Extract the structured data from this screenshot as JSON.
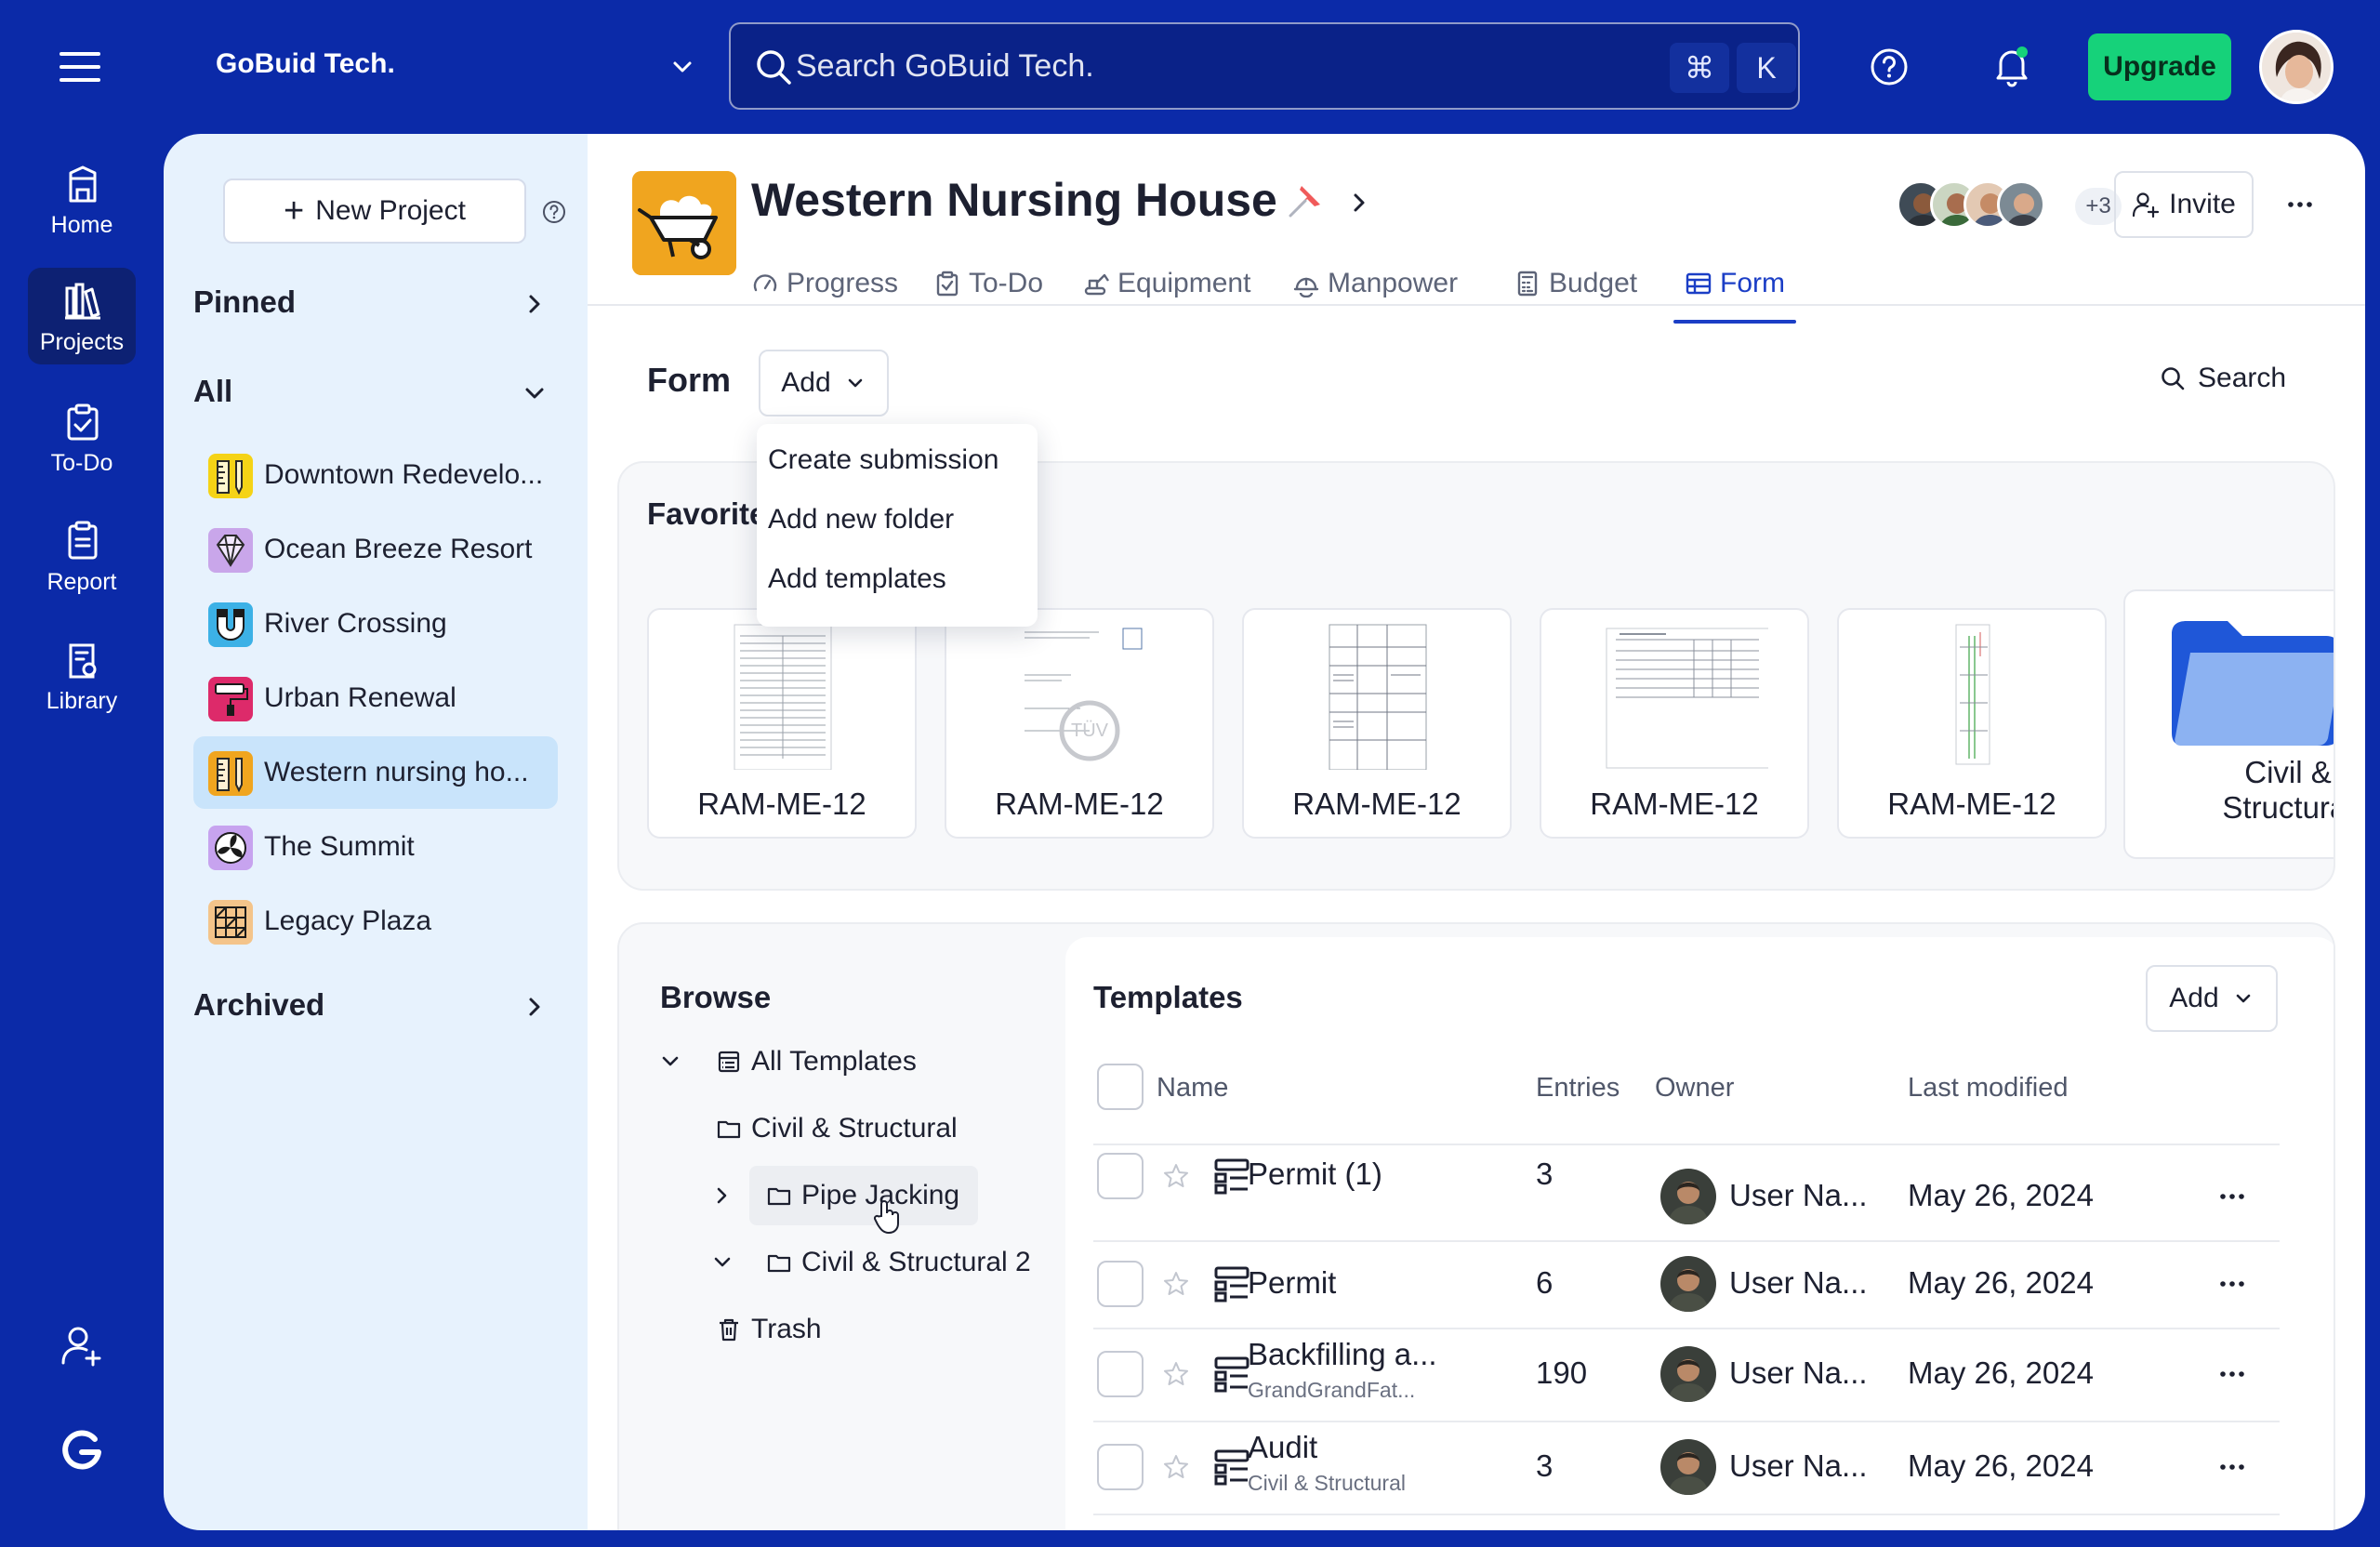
{
  "topbar": {
    "org_name": "GoBuid Tech.",
    "search_placeholder": "Search GoBuid Tech.",
    "shortcut_keys": [
      "⌘",
      "K"
    ],
    "upgrade_label": "Upgrade"
  },
  "nav": {
    "items": [
      {
        "label": "Home",
        "icon": "home-icon"
      },
      {
        "label": "Projects",
        "icon": "projects-icon",
        "active": true
      },
      {
        "label": "To-Do",
        "icon": "todo-icon"
      },
      {
        "label": "Report",
        "icon": "report-icon"
      },
      {
        "label": "Library",
        "icon": "library-icon"
      }
    ]
  },
  "sidebar": {
    "new_project_label": "New Project",
    "pinned_label": "Pinned",
    "all_label": "All",
    "archived_label": "Archived",
    "projects": [
      {
        "name": "Downtown Redevelo...",
        "color": "#f5d316"
      },
      {
        "name": "Ocean Breeze Resort",
        "color": "#b38ad8"
      },
      {
        "name": "River Crossing",
        "color": "#3cb1e6"
      },
      {
        "name": "Urban Renewal",
        "color": "#dd2a6a"
      },
      {
        "name": "Western nursing ho...",
        "color": "#f0a51f",
        "active": true
      },
      {
        "name": "The Summit",
        "color": "#b58ce6"
      },
      {
        "name": "Legacy Plaza",
        "color": "#f4b974"
      }
    ]
  },
  "project": {
    "title": "Western Nursing House",
    "tabs": [
      "Progress",
      "To-Do",
      "Equipment",
      "Manpower",
      "Budget",
      "Form"
    ],
    "active_tab": "Form",
    "extra_members": "+3",
    "invite_label": "Invite"
  },
  "form": {
    "label": "Form",
    "add_label": "Add",
    "search_label": "Search",
    "add_menu": [
      "Create submission",
      "Add new folder",
      "Add templates"
    ]
  },
  "favorites": {
    "title": "Favorites",
    "cards": [
      "RAM-ME-12",
      "RAM-ME-12",
      "RAM-ME-12",
      "RAM-ME-12",
      "RAM-ME-12"
    ],
    "folder_line1": "Civil &",
    "folder_line2": "Structural"
  },
  "browse": {
    "title": "Browse",
    "tree": [
      "All Templates",
      "Civil & Structural",
      "Pipe Jacking",
      "Civil & Structural 2",
      "Trash"
    ]
  },
  "templates": {
    "title": "Templates",
    "add_label": "Add",
    "columns": {
      "name": "Name",
      "entries": "Entries",
      "owner": "Owner",
      "last_modified": "Last modified"
    },
    "rows": [
      {
        "name": "Permit (1)",
        "sub": "",
        "entries": "3",
        "owner": "User Na...",
        "modified": "May 26, 2024"
      },
      {
        "name": "Permit",
        "sub": "",
        "entries": "6",
        "owner": "User Na...",
        "modified": "May 26, 2024"
      },
      {
        "name": "Backfilling a...",
        "sub": "GrandGrandFat...",
        "entries": "190",
        "owner": "User Na...",
        "modified": "May 26, 2024"
      },
      {
        "name": "Audit",
        "sub": "Civil & Structural",
        "entries": "3",
        "owner": "User Na...",
        "modified": "May 26, 2024"
      }
    ]
  }
}
